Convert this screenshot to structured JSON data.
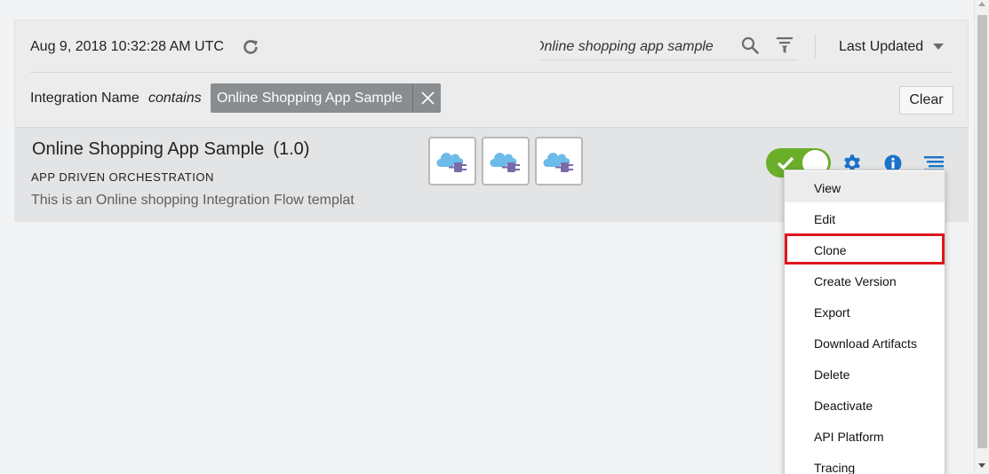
{
  "toolbar": {
    "timestamp": "Aug 9, 2018 10:32:28 AM UTC",
    "refresh_icon": "refresh-icon",
    "search_value": "Online shopping app sample",
    "search_icon": "search-icon",
    "filter_icon": "filter-icon",
    "sort_label": "Last Updated",
    "sort_icon": "caret-down-icon"
  },
  "filter_bar": {
    "field_label": "Integration Name",
    "operator": "contains",
    "chip_value": "Online Shopping App Sample",
    "chip_close_icon": "close-icon",
    "clear_label": "Clear"
  },
  "integration": {
    "name": "Online Shopping App Sample",
    "version": "(1.0)",
    "type": "APP DRIVEN ORCHESTRATION",
    "description": "This is an Online shopping Integration Flow templat",
    "adapters": [
      {
        "icon": "cloud-plug-icon"
      },
      {
        "icon": "cloud-plug-icon"
      },
      {
        "icon": "cloud-plug-icon"
      }
    ],
    "active": true,
    "actions": [
      "gear-icon",
      "info-icon",
      "hamburger-menu-icon"
    ]
  },
  "menu": {
    "items": [
      {
        "label": "View"
      },
      {
        "label": "Edit"
      },
      {
        "label": "Clone"
      },
      {
        "label": "Create Version"
      },
      {
        "label": "Export"
      },
      {
        "label": "Download Artifacts"
      },
      {
        "label": "Delete"
      },
      {
        "label": "Deactivate"
      },
      {
        "label": "API Platform"
      },
      {
        "label": "Tracing"
      }
    ],
    "hovered_item": "View",
    "highlighted_item": "Clone"
  },
  "colors": {
    "toggle_on": "#6bae2a",
    "icon_blue": "#1a73c8",
    "chip_bg": "#8a8d90",
    "highlight_border": "#e0161d",
    "cloud": "#6cbbe8",
    "plug": "#7b6aa8"
  }
}
